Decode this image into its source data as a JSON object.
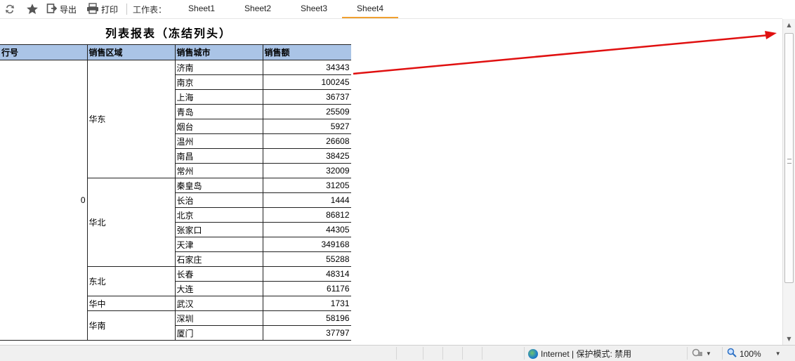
{
  "toolbar": {
    "export_label": "导出",
    "print_label": "打印",
    "worksheet_label": "工作表：",
    "sheets": [
      "Sheet1",
      "Sheet2",
      "Sheet3",
      "Sheet4"
    ],
    "active_sheet": "Sheet4"
  },
  "report": {
    "title": "列表报表（冻结列头）",
    "headers": [
      "行号",
      "销售区域",
      "销售城市",
      "销售额"
    ],
    "row_number": "0",
    "groups": [
      {
        "region": "华东",
        "rows": [
          {
            "city": "济南",
            "amount": "34343"
          },
          {
            "city": "南京",
            "amount": "100245"
          },
          {
            "city": "上海",
            "amount": "36737"
          },
          {
            "city": "青岛",
            "amount": "25509"
          },
          {
            "city": "烟台",
            "amount": "5927"
          },
          {
            "city": "温州",
            "amount": "26608"
          },
          {
            "city": "南昌",
            "amount": "38425"
          },
          {
            "city": "常州",
            "amount": "32009"
          }
        ]
      },
      {
        "region": "华北",
        "rows": [
          {
            "city": "秦皇岛",
            "amount": "31205"
          },
          {
            "city": "长治",
            "amount": "1444"
          },
          {
            "city": "北京",
            "amount": "86812"
          },
          {
            "city": "张家口",
            "amount": "44305"
          },
          {
            "city": "天津",
            "amount": "349168"
          },
          {
            "city": "石家庄",
            "amount": "55288"
          }
        ]
      },
      {
        "region": "东北",
        "rows": [
          {
            "city": "长春",
            "amount": "48314"
          },
          {
            "city": "大连",
            "amount": "61176"
          }
        ]
      },
      {
        "region": "华中",
        "rows": [
          {
            "city": "武汉",
            "amount": "1731"
          }
        ]
      },
      {
        "region": "华南",
        "rows": [
          {
            "city": "深圳",
            "amount": "58196"
          },
          {
            "city": "厦门",
            "amount": "37797"
          }
        ]
      }
    ]
  },
  "statusbar": {
    "zone": "Internet | 保护模式: 禁用",
    "zoom": "100%"
  },
  "colors": {
    "header_bg": "#aac4e6",
    "tab_accent": "#f0a030",
    "arrow": "#e01010"
  }
}
